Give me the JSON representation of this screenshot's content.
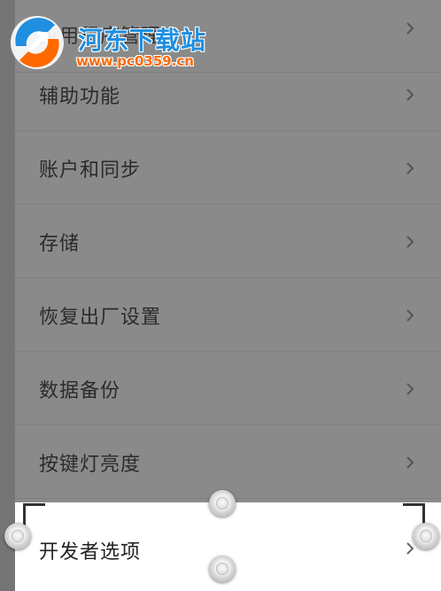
{
  "settings": {
    "items": [
      {
        "label": "应用程序管理"
      },
      {
        "label": "辅助功能"
      },
      {
        "label": "账户和同步"
      },
      {
        "label": "存储"
      },
      {
        "label": "恢复出厂设置"
      },
      {
        "label": "数据备份"
      },
      {
        "label": "按键灯亮度"
      },
      {
        "label": "开发者选项"
      }
    ],
    "highlighted_index": 7
  },
  "watermark": {
    "title": "河东下载站",
    "url": "www.pc0359.cn"
  },
  "colors": {
    "dim_overlay": "#8a8a8a",
    "highlight_bg": "#ffffff",
    "watermark_title": "#1f8fe0",
    "watermark_url": "#ff6a00"
  },
  "icons": {
    "chevron": "chevron-right-icon",
    "selection_handle": "selection-handle-icon"
  }
}
